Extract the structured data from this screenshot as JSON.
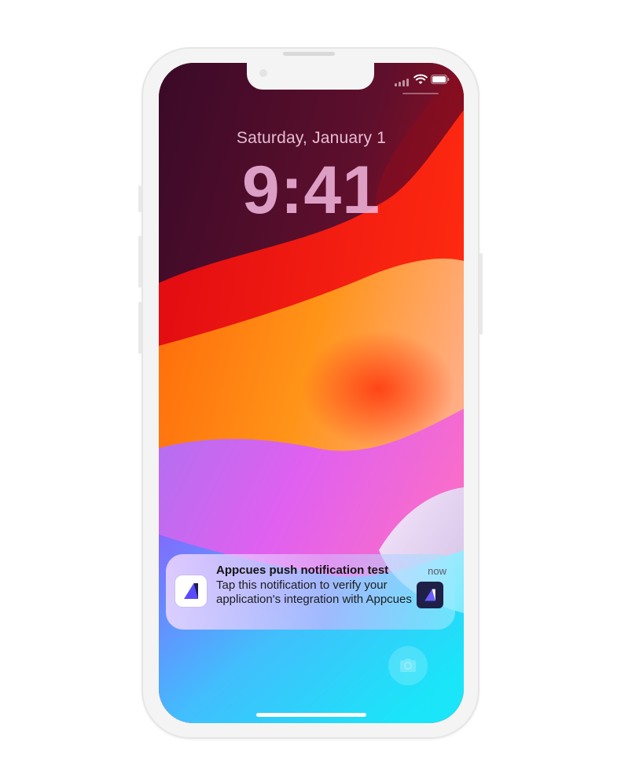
{
  "lock_screen": {
    "date": "Saturday, January 1",
    "time": "9:41"
  },
  "notification": {
    "title": "Appcues push notification test",
    "body": "Tap this notification to verify your application's integration with Appcues",
    "timestamp": "now",
    "app_icon": "appcues-logo-icon",
    "thumbnail": "appcues-logo-icon"
  },
  "status_bar": {
    "icons": [
      "cellular-signal-icon",
      "wifi-icon",
      "battery-icon"
    ]
  },
  "quick_actions": {
    "camera_icon": "camera-icon"
  },
  "colors": {
    "brand_dark": "#1e2048",
    "brand_accent": "#5b4bff"
  }
}
